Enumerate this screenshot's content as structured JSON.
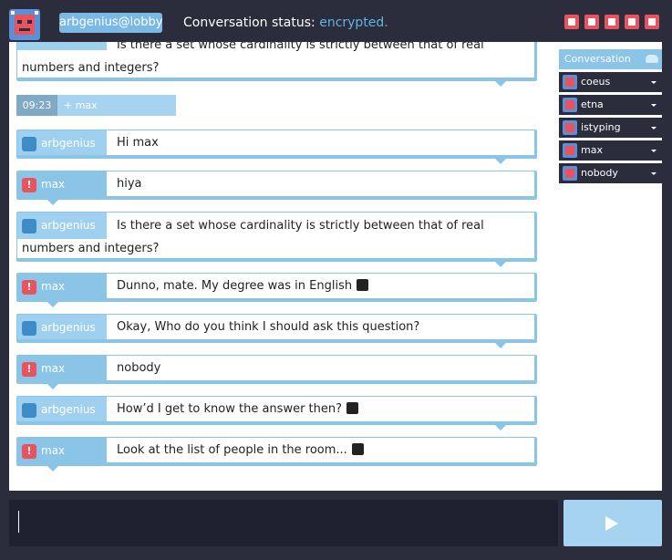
{
  "header": {
    "nick": "arbgenius@lobby",
    "status_label": "Conversation status:",
    "status_value": "encrypted.",
    "icons": [
      "smiley-icon",
      "filter-icon",
      "chat-icon",
      "sound-icon",
      "eject-icon"
    ]
  },
  "sidebar": {
    "title": "Conversation",
    "users": [
      {
        "name": "coeus"
      },
      {
        "name": "etna"
      },
      {
        "name": "istyping"
      },
      {
        "name": "max"
      },
      {
        "name": "nobody"
      }
    ]
  },
  "join": {
    "time": "09:23",
    "text": "+ max"
  },
  "messages": [
    {
      "who": "arbgenius",
      "text": "Is there a set whose cardinality is strictly between that of real numbers and integers?",
      "cut": true
    },
    {
      "who": "arbgenius",
      "text": "Hi max"
    },
    {
      "who": "max",
      "text": "hiya"
    },
    {
      "who": "arbgenius",
      "text": "Is there a set whose cardinality is strictly between that of real numbers and integers?"
    },
    {
      "who": "max",
      "text": "Dunno, mate.  My degree was in English"
    },
    {
      "who": "arbgenius",
      "text": "Okay, Who do you think I should ask this question?"
    },
    {
      "who": "max",
      "text": "nobody"
    },
    {
      "who": "arbgenius",
      "text": "How’d I get to know the answer then?"
    },
    {
      "who": "max",
      "text": "Look at the list of people in the room..."
    }
  ],
  "colors": {
    "accent": "#8ac4e7",
    "alert": "#e8535e",
    "dark": "#2b2d3c",
    "encrypted": "#5fb3e6"
  }
}
